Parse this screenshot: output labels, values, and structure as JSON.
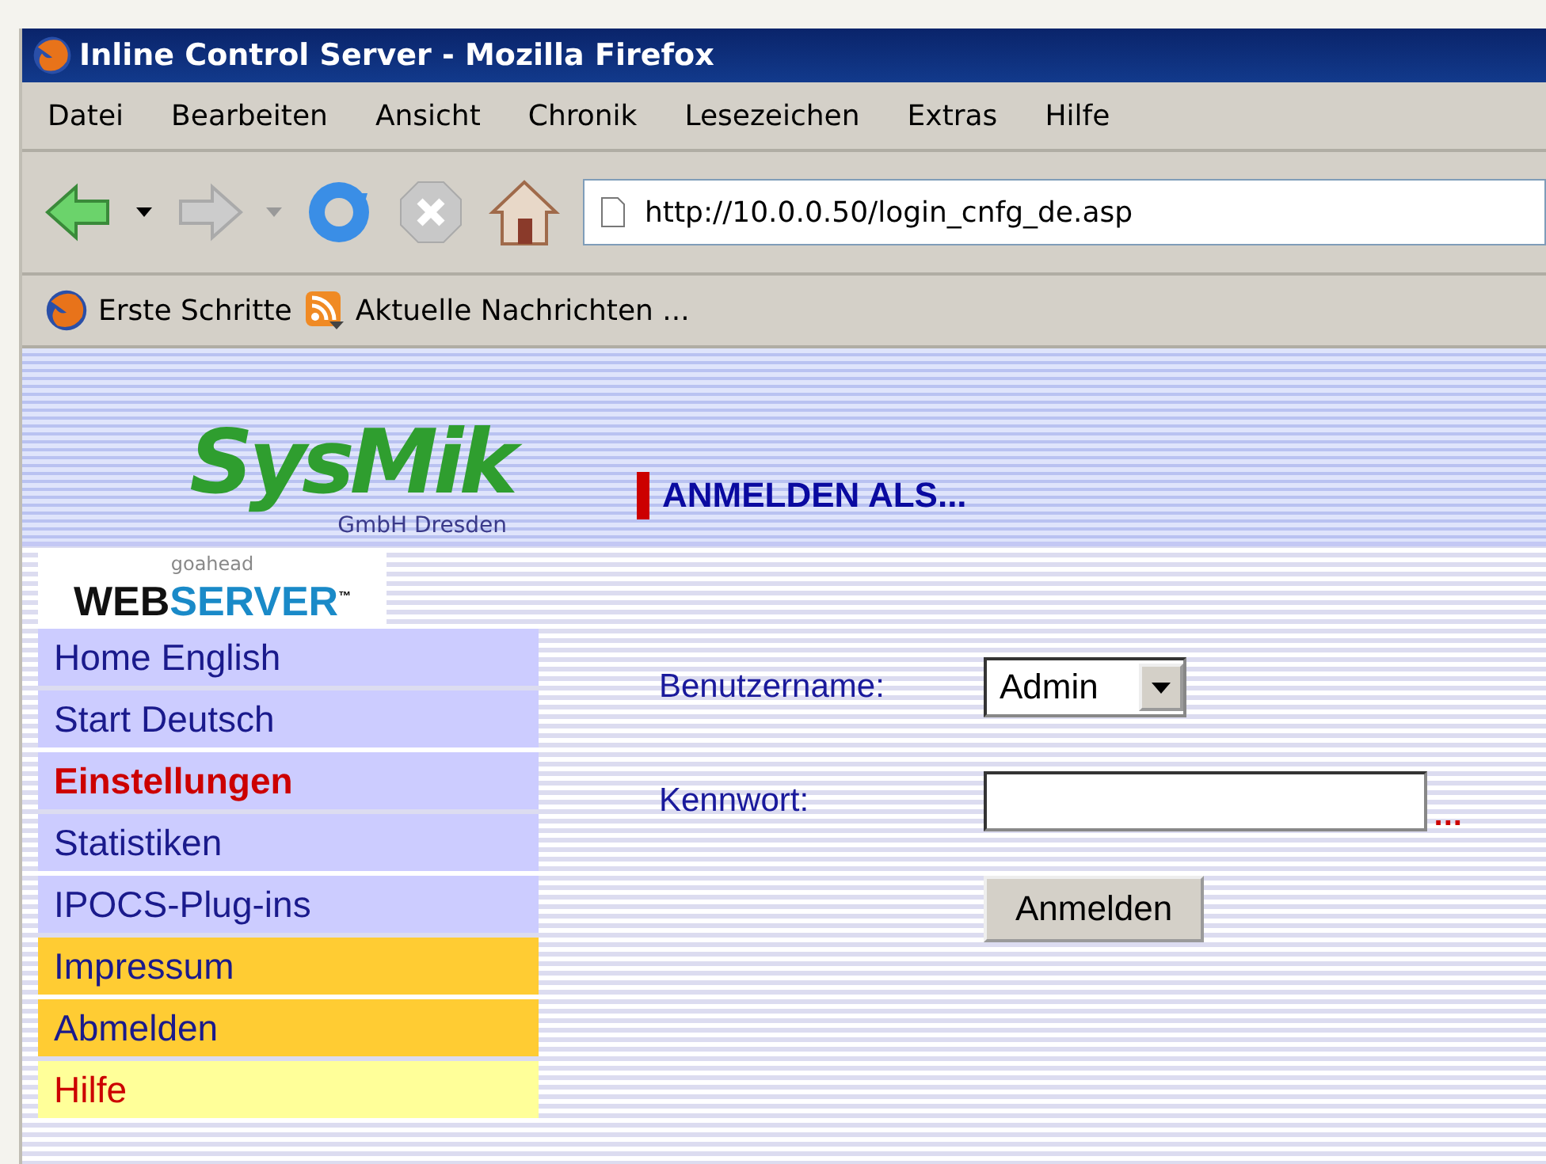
{
  "window": {
    "title": "Inline Control Server - Mozilla Firefox"
  },
  "menu": [
    "Datei",
    "Bearbeiten",
    "Ansicht",
    "Chronik",
    "Lesezeichen",
    "Extras",
    "Hilfe"
  ],
  "address": "http://10.0.0.50/login_cnfg_de.asp",
  "bookmarks": [
    {
      "kind": "firefox",
      "label": "Erste Schritte"
    },
    {
      "kind": "feed",
      "label": "Aktuelle Nachrichten ..."
    }
  ],
  "logo": {
    "name": "SysMik",
    "subtitle": "GmbH Dresden"
  },
  "server_logo": {
    "small": "goahead",
    "first": "WEB",
    "second": "SERVER",
    "mark": "™"
  },
  "heading": "ANMELDEN ALS...",
  "sidebar": {
    "items": [
      {
        "label": "Home English",
        "kind": "nav",
        "selected": false
      },
      {
        "label": "Start Deutsch",
        "kind": "nav",
        "selected": false
      },
      {
        "label": "Einstellungen",
        "kind": "nav",
        "selected": true
      },
      {
        "label": "Statistiken",
        "kind": "nav",
        "selected": false
      },
      {
        "label": "IPOCS-Plug-ins",
        "kind": "nav",
        "selected": false
      },
      {
        "label": "Impressum",
        "kind": "info",
        "selected": false
      },
      {
        "label": "Abmelden",
        "kind": "info",
        "selected": false
      },
      {
        "label": "Hilfe",
        "kind": "help",
        "selected": false
      }
    ]
  },
  "form": {
    "username_label": "Benutzername:",
    "username_value": "Admin",
    "password_label": "Kennwort:",
    "required_mark": "...",
    "submit": "Anmelden"
  }
}
